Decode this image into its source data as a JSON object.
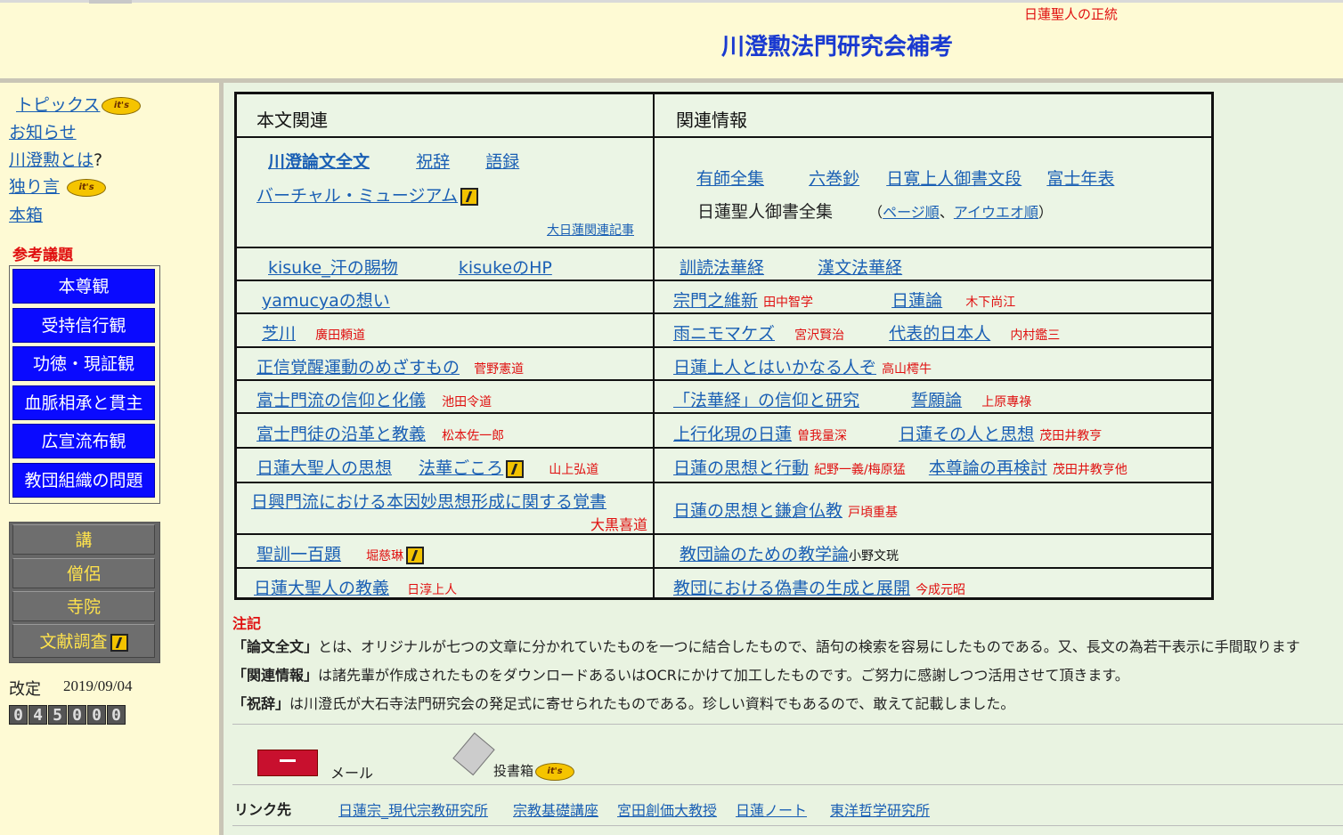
{
  "header": {
    "slogan": "日蓮聖人の正統",
    "title": "川澄勲法門研究会補考"
  },
  "sidebar": {
    "links": [
      "トピックス",
      "お知らせ",
      "川澄勲とは",
      "独り言",
      "本箱"
    ],
    "qmark": "?",
    "its_badge": "it's",
    "topics_heading": "参考議題",
    "topics": [
      "本尊観",
      "受持信行観",
      "功徳・現証観",
      "血脈相承と貫主",
      "広宣流布観",
      "教団組織の問題"
    ],
    "gray": [
      "講",
      "僧侶",
      "寺院",
      "文献調査"
    ],
    "revised_label": "改定",
    "revised_date": "2019/09/04",
    "counter": [
      "0",
      "4",
      "5",
      "0",
      "0",
      "0"
    ]
  },
  "grid": {
    "col1_head": "本文関連",
    "col2_head": "関連情報",
    "r1": {
      "a": "川澄論文全文",
      "b": "祝辞",
      "c": "語録",
      "d": "バーチャル・ミュージアム",
      "e": "大日蓮関連記事",
      "f": "有師全集",
      "g": "六巻鈔",
      "h": "日寛上人御書文段",
      "i": "富士年表",
      "j": "日蓮聖人御書全集",
      "k_open": "（",
      "k": "ページ順",
      "k_sep": "、",
      "l": "アイウエオ順",
      "k_close": "）"
    },
    "r2": {
      "a": "kisuke_汗の賜物",
      "b": "kisukeのHP",
      "c": "訓読法華経",
      "d": "漢文法華経"
    },
    "r3": {
      "a": "yamucyaの想い",
      "b": "宗門之維新",
      "b_author": "田中智学",
      "c": "日蓮論",
      "c_author": "木下尚江"
    },
    "r4": {
      "a": "芝川",
      "a_author": "廣田頼道",
      "b": "雨ニモマケズ",
      "b_author": "宮沢賢治",
      "c": "代表的日本人",
      "c_author": "内村鑑三"
    },
    "r5": {
      "a": "正信覚醒運動のめざすもの",
      "a_author": "菅野憲道",
      "b": "日蓮上人とはいかなる人ぞ",
      "b_author": "高山樗牛"
    },
    "r6": {
      "a": "富士門流の信仰と化儀",
      "a_author": "池田令道",
      "b": "「法華経」の信仰と研究",
      "c": "誓願論",
      "c_author": "上原專祿"
    },
    "r7": {
      "a": "富士門徒の沿革と教義",
      "a_author": "松本佐一郎",
      "b": "上行化現の日蓮",
      "b_author": "曽我量深",
      "c": "日蓮その人と思想",
      "c_author": "茂田井教亨"
    },
    "r8": {
      "a": "日蓮大聖人の思想",
      "b": "法華ごころ",
      "b_author": "山上弘道",
      "c": "日蓮の思想と行動",
      "c_author": "紀野一義/梅原猛",
      "d": "本尊論の再検討",
      "d_author": "茂田井教亨他"
    },
    "r9": {
      "a": "日興門流における本因妙思想形成に関する覚書",
      "a_author": "大黒喜道",
      "b": "日蓮の思想と鎌倉仏教",
      "b_author": "戸頃重基"
    },
    "r10": {
      "a": "聖訓一百題",
      "a_author": "堀慈琳",
      "b": "教団論のための教学論",
      "b_author": "小野文珖"
    },
    "r11": {
      "a": "日蓮大聖人の教義",
      "a_author": "日淳上人",
      "b": "教団における偽書の生成と展開",
      "b_author": "今成元昭"
    }
  },
  "notes": {
    "title": "注記",
    "n1_key": "「論文全文」",
    "n1": "とは、オリジナルが七つの文章に分かれていたものを一つに結合したもので、語句の検索を容易にしたものである。又、長文の為若干表示に手間取ります",
    "n2_key": "「関連情報」",
    "n2": "は諸先輩が作成されたものをダウンロードあるいはOCRにかけて加工したものです。ご努力に感謝しつつ活用させて頂きます。",
    "n3_key": "「祝辞」",
    "n3": "は川澄氏が大石寺法門研究会の発足式に寄せられたものである。珍しい資料でもあるので、敢えて記載しました。"
  },
  "footer": {
    "mail": "メール",
    "postbox": "投書箱",
    "links_heading": "リンク先",
    "links": [
      "日蓮宗_現代宗教研究所",
      "宗教基礎講座",
      "宮田創価大教授",
      "日蓮ノート",
      "東洋哲学研究所"
    ]
  },
  "colors": {
    "accent_blue": "#0a0aff",
    "link": "#1a5fb4",
    "author_red": "#e01010",
    "bg": "#fdfbd6"
  }
}
